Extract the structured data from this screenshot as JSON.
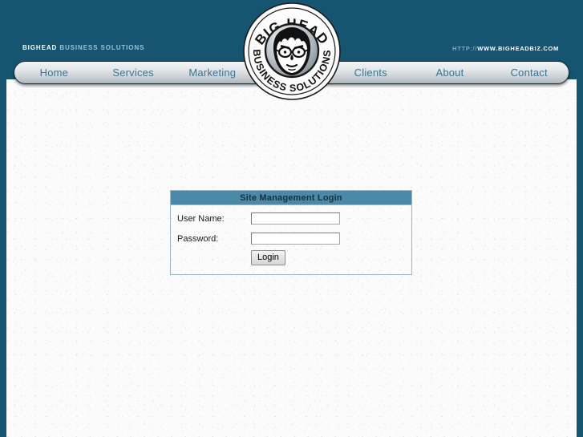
{
  "site": {
    "brand_bold": "BIGHEAD",
    "brand_rest": " BUSINESS SOLUTIONS",
    "url_protocol": "HTTP://",
    "url_domain": "WWW.BIGHEADBIZ.COM"
  },
  "logo": {
    "top_arc_text": "BIG HEAD",
    "bottom_arc_text": "BUSINESS SOLUTIONS",
    "icon": "bighead-face-logo"
  },
  "nav": {
    "items": [
      {
        "label": "Home"
      },
      {
        "label": "Services"
      },
      {
        "label": "Marketing"
      },
      {
        "label": "Clients"
      },
      {
        "label": "About"
      },
      {
        "label": "Contact"
      }
    ]
  },
  "login": {
    "title": "Site Management Login",
    "username_label": "User Name:",
    "username_value": "",
    "username_placeholder": "",
    "password_label": "Password:",
    "password_value": "",
    "password_placeholder": "",
    "submit_label": "Login"
  },
  "colors": {
    "header_teal": "#155572",
    "title_bar_blue": "#4a8aa8",
    "nav_text": "#39768f",
    "page_background": "#fbfbfb"
  }
}
